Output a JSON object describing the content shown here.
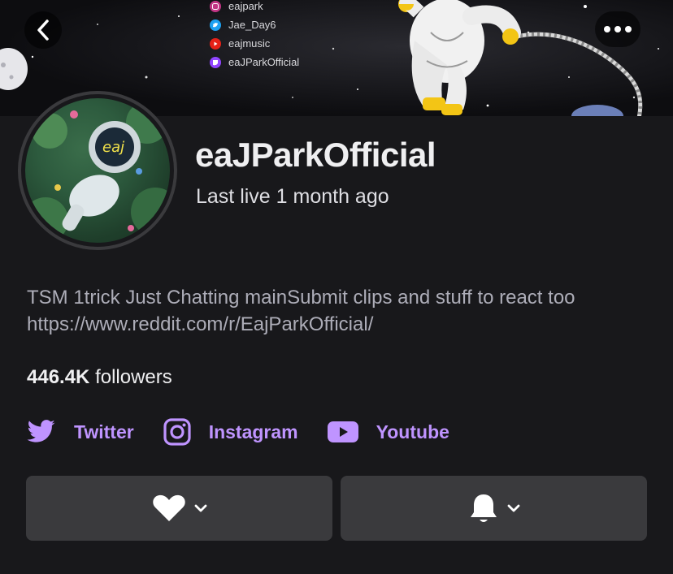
{
  "banner": {
    "social_handles": [
      {
        "icon": "instagram-icon",
        "label": "eajpark",
        "color": "#c13584"
      },
      {
        "icon": "twitter-icon",
        "label": "Jae_Day6",
        "color": "#1da1f2"
      },
      {
        "icon": "youtube-icon",
        "label": "eajmusic",
        "color": "#e62117"
      },
      {
        "icon": "twitch-icon",
        "label": "eaJParkOfficial",
        "color": "#9146ff"
      }
    ]
  },
  "header": {
    "back_icon": "chevron-left-icon",
    "more_icon": "ellipsis-icon"
  },
  "profile": {
    "avatar_text": "eaj",
    "channel_name": "eaJParkOfficial",
    "last_live": "Last live 1 month ago",
    "bio": "TSM 1trick Just Chatting mainSubmit clips and stuff to react too https://www.reddit.com/r/EajParkOfficial/",
    "followers_count": "446.4K",
    "followers_label": "followers"
  },
  "links": [
    {
      "icon": "twitter-icon",
      "label": "Twitter"
    },
    {
      "icon": "instagram-icon",
      "label": "Instagram"
    },
    {
      "icon": "youtube-icon",
      "label": "Youtube"
    }
  ],
  "actions": {
    "follow_icon": "heart-icon",
    "notify_icon": "bell-icon"
  },
  "colors": {
    "accent": "#bf94ff",
    "background": "#18181b",
    "button_bg": "#3a3a3d"
  }
}
